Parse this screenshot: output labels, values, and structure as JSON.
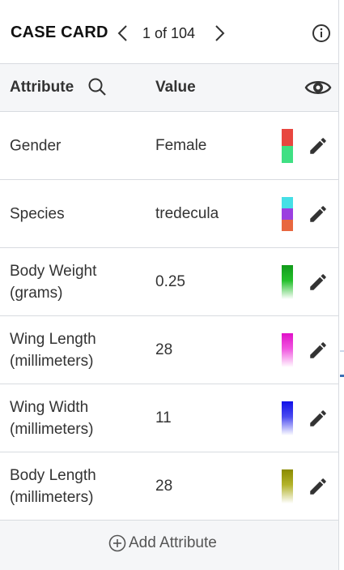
{
  "header": {
    "title": "CASE CARD",
    "counter": "1 of 104"
  },
  "columns": {
    "attribute": "Attribute",
    "value": "Value"
  },
  "rows": [
    {
      "name": "Gender",
      "value": "Female",
      "legend_colors": [
        "#e8463f",
        "#3fe083"
      ]
    },
    {
      "name": "Species",
      "value": "tredecula",
      "legend_colors": [
        "#45dfe6",
        "#9b3fe0",
        "#e8673f"
      ]
    },
    {
      "name": "Body Weight (grams)",
      "value": "0.25",
      "gradient": [
        "#119a1a",
        "#ffffff"
      ]
    },
    {
      "name": "Wing Length (millimeters)",
      "value": "28",
      "gradient": [
        "#e010c8",
        "#ffffff"
      ]
    },
    {
      "name": "Wing Width (millimeters)",
      "value": "11",
      "gradient": [
        "#1010e8",
        "#ffffff"
      ]
    },
    {
      "name": "Body Length (millimeters)",
      "value": "28",
      "gradient": [
        "#8a8a00",
        "#ffffff"
      ]
    }
  ],
  "footer": {
    "add_label": "Add Attribute"
  },
  "icons": {
    "prev": "chevron-left-icon",
    "next": "chevron-right-icon",
    "info": "info-icon",
    "search": "search-icon",
    "visibility": "eye-icon",
    "edit": "pencil-icon",
    "add": "plus-circle-icon"
  }
}
